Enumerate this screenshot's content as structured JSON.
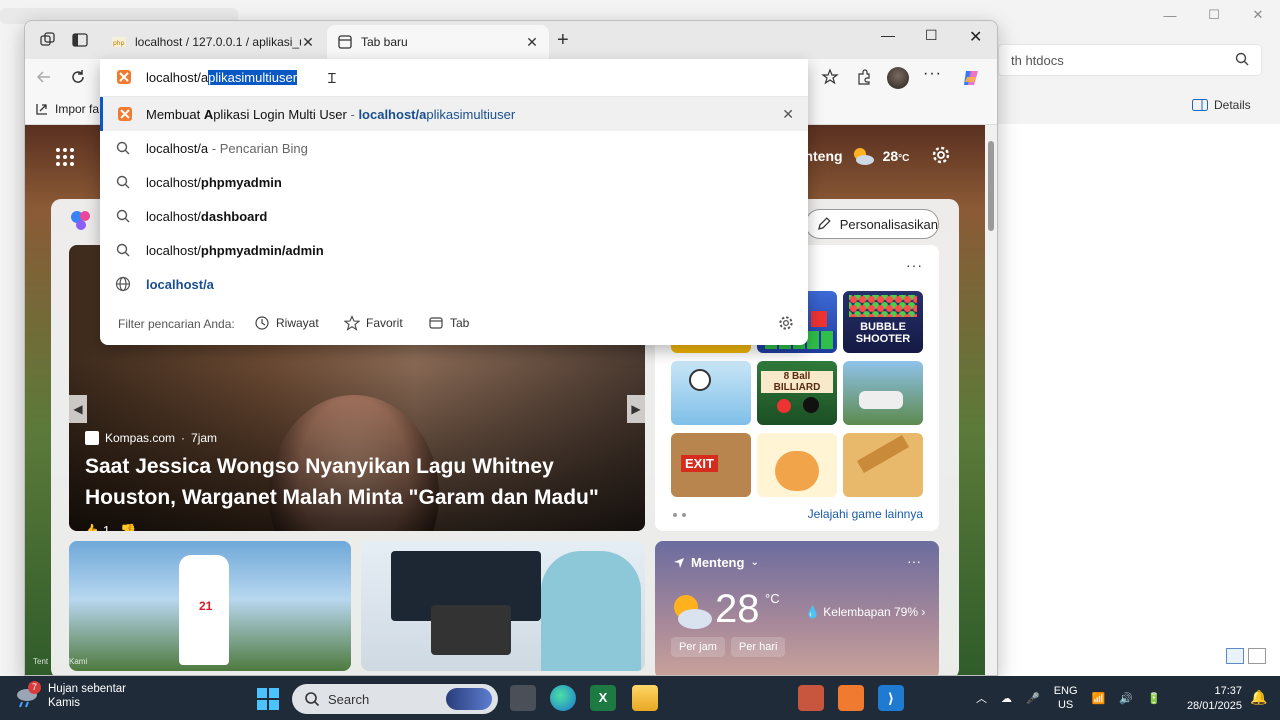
{
  "explorer": {
    "search_placeholder": "th htdocs",
    "details_label": "Details"
  },
  "browser": {
    "tabs": [
      {
        "title": "localhost / 127.0.0.1 / aplikasi_uas",
        "active": false
      },
      {
        "title": "Tab baru",
        "active": true
      }
    ],
    "bookmark_label": "Impor fa"
  },
  "omnibox": {
    "typed": "localhost/a",
    "autocomplete": "plikasimultiuser",
    "suggestions": [
      {
        "kind": "history",
        "pre": "Membuat ",
        "bold": "A",
        "post": "plikasi Login Multi User",
        "sep": " - ",
        "url_pre": "localhost/a",
        "url_post": "plikasimultiuser"
      },
      {
        "kind": "search",
        "pre": "localhost/a",
        "bold": "",
        "post": " - Pencarian Bing"
      },
      {
        "kind": "search",
        "pre": "localhost/",
        "bold": "phpmyadmin"
      },
      {
        "kind": "search",
        "pre": "localhost/",
        "bold": "dashboard"
      },
      {
        "kind": "search",
        "pre": "localhost/",
        "bold": "phpmyadmin/admin"
      },
      {
        "kind": "web",
        "pre": "localhost/a"
      }
    ],
    "filter_label": "Filter pencarian Anda:",
    "filters": [
      "Riwayat",
      "Favorit",
      "Tab"
    ]
  },
  "newtab": {
    "weather_location": "Menteng",
    "weather_temp": "28",
    "weather_unit": "°C",
    "personalize_label": "Personalisasikan",
    "hero": {
      "source": "Kompas.com",
      "age": "7jam",
      "headline": "Saat Jessica Wongso Nyanyikan Lagu Whitney Houston, Warganet Malah Minta \"Garam dan Madu\"",
      "likes": "1"
    },
    "games": {
      "tiles": [
        "",
        "",
        "BUBBLE SHOOTER",
        "",
        "8 Ball BILLIARD",
        "",
        "EXIT",
        "",
        ""
      ],
      "more_link": "Jelajahi game lainnya"
    },
    "weather_card": {
      "location": "Menteng",
      "temp": "28",
      "unit": "°C",
      "humidity": "Kelembapan 79%",
      "tabs": [
        "Per jam",
        "Per hari"
      ]
    },
    "footer_fragments": [
      "Tent",
      "Kami"
    ]
  },
  "taskbar": {
    "weather_title": "Hujan sebentar",
    "weather_sub": "Kamis",
    "weather_badge": "7",
    "search_label": "Search",
    "lang_top": "ENG",
    "lang_bottom": "US",
    "time": "17:37",
    "date": "28/01/2025"
  },
  "colors": {
    "accent": "#0a58c4",
    "taskbar": "#1f2b38",
    "xampp": "#f07b30"
  }
}
